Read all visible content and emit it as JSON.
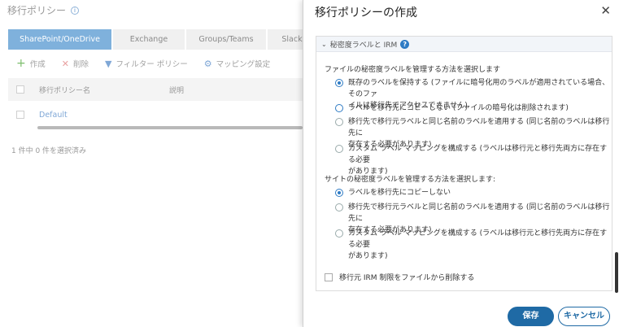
{
  "page": {
    "title": "移行ポリシー",
    "info_icon": "i",
    "tabs": [
      "SharePoint/OneDrive",
      "Exchange",
      "Groups/Teams",
      "Slack"
    ],
    "toolbar": {
      "add": "作成",
      "delete": "削除",
      "filter": "フィルター ポリシー",
      "mapping": "マッピング設定"
    },
    "grid": {
      "columns": [
        "移行ポリシー名",
        "説明"
      ],
      "rows": [
        {
          "name": "Default"
        }
      ]
    },
    "selection_count": "1 件中 0 件を選択済み"
  },
  "dialog": {
    "title": "移行ポリシーの作成",
    "close_icon": "✕",
    "section": {
      "title": "秘密度ラベルと IRM",
      "help_icon": "?"
    },
    "file_group": {
      "label": "ファイルの秘密度ラベルを管理する方法を選択します",
      "options": [
        {
          "line1": "既存のラベルを保持する (ファイルに暗号化用のラベルが適用されている場合、そのファ",
          "line2": "イルは移行先でアクセスできません)",
          "checked": true
        },
        {
          "line1": "ラベルを移行先にコピーしない (ファイルの暗号化は削除されます)",
          "line2": "",
          "checked": false
        },
        {
          "line1": "移行先で移行元ラベルと同じ名前のラベルを適用する (同じ名前のラベルは移行先に",
          "line2": "存在する必要があります)",
          "checked": false
        },
        {
          "line1": "カスタム ラベル マッピングを構成する (ラベルは移行元と移行先両方に存在する必要",
          "line2": "があります)",
          "checked": false
        }
      ]
    },
    "site_group": {
      "label": "サイトの秘密度ラベルを管理する方法を選択します:",
      "options": [
        {
          "line1": "ラベルを移行先にコピーしない",
          "line2": "",
          "checked": true
        },
        {
          "line1": "移行先で移行元ラベルと同じ名前のラベルを適用する (同じ名前のラベルは移行先に",
          "line2": "存在する必要があります)",
          "checked": false
        },
        {
          "line1": "カスタム ラベル マッピングを構成する (ラベルは移行元と移行先両方に存在する必要",
          "line2": "があります)",
          "checked": false
        }
      ]
    },
    "irm_checkbox": {
      "label": "移行元 IRM 制限をファイルから削除する",
      "checked": false
    },
    "buttons": {
      "save": "保存",
      "cancel": "キャンセル"
    }
  },
  "colors": {
    "primary": "#1f6aa5",
    "tab_active": "#7fb1dc",
    "link": "#7fa7d6"
  }
}
